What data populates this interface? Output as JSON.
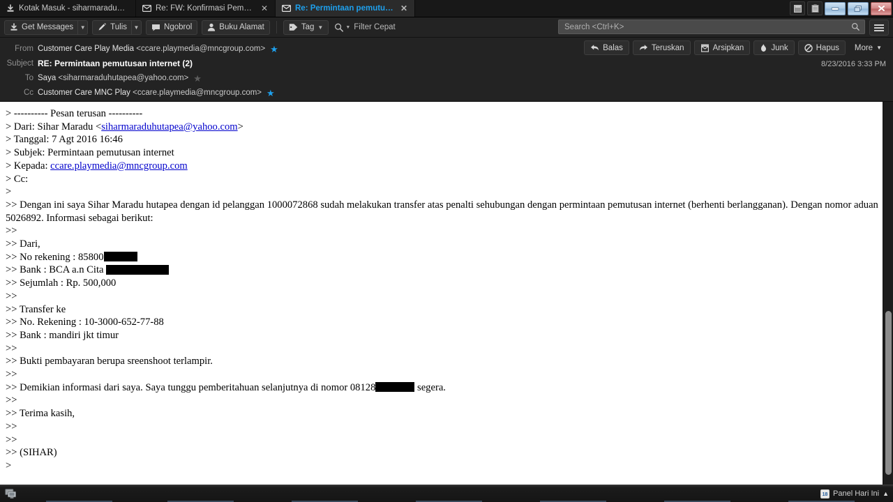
{
  "window": {
    "controls": {
      "minimize": "minimize-button",
      "restore": "restore-button",
      "close": "close-button"
    }
  },
  "tabs": [
    {
      "label": "Kotak Masuk - siharmaraduhuta...",
      "icon": "inbox-download-icon",
      "active": false,
      "closable": false
    },
    {
      "label": "Re: FW: Konfirmasi Pembay...",
      "icon": "mail-icon",
      "active": false,
      "closable": true
    },
    {
      "label": "Re: Permintaan pemutusa...",
      "icon": "mail-icon",
      "active": true,
      "closable": true
    }
  ],
  "toolbar": {
    "get_messages": "Get Messages",
    "write": "Tulis",
    "chat": "Ngobrol",
    "address_book": "Buku Alamat",
    "tag": "Tag",
    "quick_filter": "Filter Cepat",
    "search_placeholder": "Search <Ctrl+K>",
    "search_value": "",
    "menu": "app-menu"
  },
  "message": {
    "labels": {
      "from": "From",
      "subject": "Subject",
      "to": "To",
      "cc": "Cc"
    },
    "from_name": "Customer Care Play Media",
    "from_addr": "<ccare.playmedia@mncgroup.com>",
    "from_starred": true,
    "subject": "RE: Permintaan pemutusan internet (2)",
    "to_name": "Saya",
    "to_addr": "<siharmaraduhutapea@yahoo.com>",
    "to_starred": false,
    "cc_name": "Customer Care MNC Play",
    "cc_addr": "<ccare.playmedia@mncgroup.com>",
    "cc_starred": true,
    "date": "8/23/2016 3:33 PM"
  },
  "actions": {
    "reply": "Balas",
    "forward": "Teruskan",
    "archive": "Arsipkan",
    "junk": "Junk",
    "delete": "Hapus",
    "more": "More"
  },
  "body_lines": [
    {
      "text": "> ---------- Pesan terusan ----------"
    },
    {
      "pre": "> Dari: Sihar Maradu <",
      "link": "siharmaraduhutapea@yahoo.com",
      "post": ">"
    },
    {
      "text": "> Tanggal: 7 Agt 2016 16:46"
    },
    {
      "text": "> Subjek: Permintaan pemutusan internet"
    },
    {
      "pre": "> Kepada: ",
      "link": "ccare.playmedia@mncgroup.com",
      "post": ""
    },
    {
      "text": "> Cc:"
    },
    {
      "text": ">"
    },
    {
      "text": ">> Dengan ini saya Sihar Maradu hutapea dengan id pelanggan 1000072868 sudah melakukan transfer atas penalti sehubungan dengan permintaan pemutusan internet (berhenti berlangganan). Dengan nomor aduan 5026892. Informasi sebagai berikut:"
    },
    {
      "text": ">>"
    },
    {
      "text": ">> Dari,"
    },
    {
      "pre": ">> No rekening : 85800",
      "redact_width": 48,
      "post": ""
    },
    {
      "pre": ">> Bank : BCA a.n Cita ",
      "redact_width": 90,
      "post": ""
    },
    {
      "text": ">> Sejumlah : Rp. 500,000"
    },
    {
      "text": ">>"
    },
    {
      "text": ">> Transfer ke"
    },
    {
      "text": ">> No. Rekening : 10-3000-652-77-88"
    },
    {
      "text": ">> Bank : mandiri jkt timur"
    },
    {
      "text": ">>"
    },
    {
      "text": ">> Bukti pembayaran berupa sreenshoot terlampir."
    },
    {
      "text": ">>"
    },
    {
      "pre": ">> Demikian informasi dari saya. Saya tunggu pemberitahuan selanjutnya di nomor 08128",
      "redact_width": 56,
      "post": " segera."
    },
    {
      "text": ">>"
    },
    {
      "text": ">> Terima kasih,"
    },
    {
      "text": ">>"
    },
    {
      "text": ">>"
    },
    {
      "text": ">> (SIHAR)"
    },
    {
      "text": ">"
    }
  ],
  "taskbar": {
    "tray_label": "Panel Hari Ini",
    "tray_icon": "calendar-icon",
    "tray_day": "18",
    "app_icon": "computer-icon"
  },
  "colors": {
    "accent": "#1ea0ed",
    "toolbar_bg": "#232323",
    "body_bg": "#ffffff",
    "link": "#0000cc"
  }
}
